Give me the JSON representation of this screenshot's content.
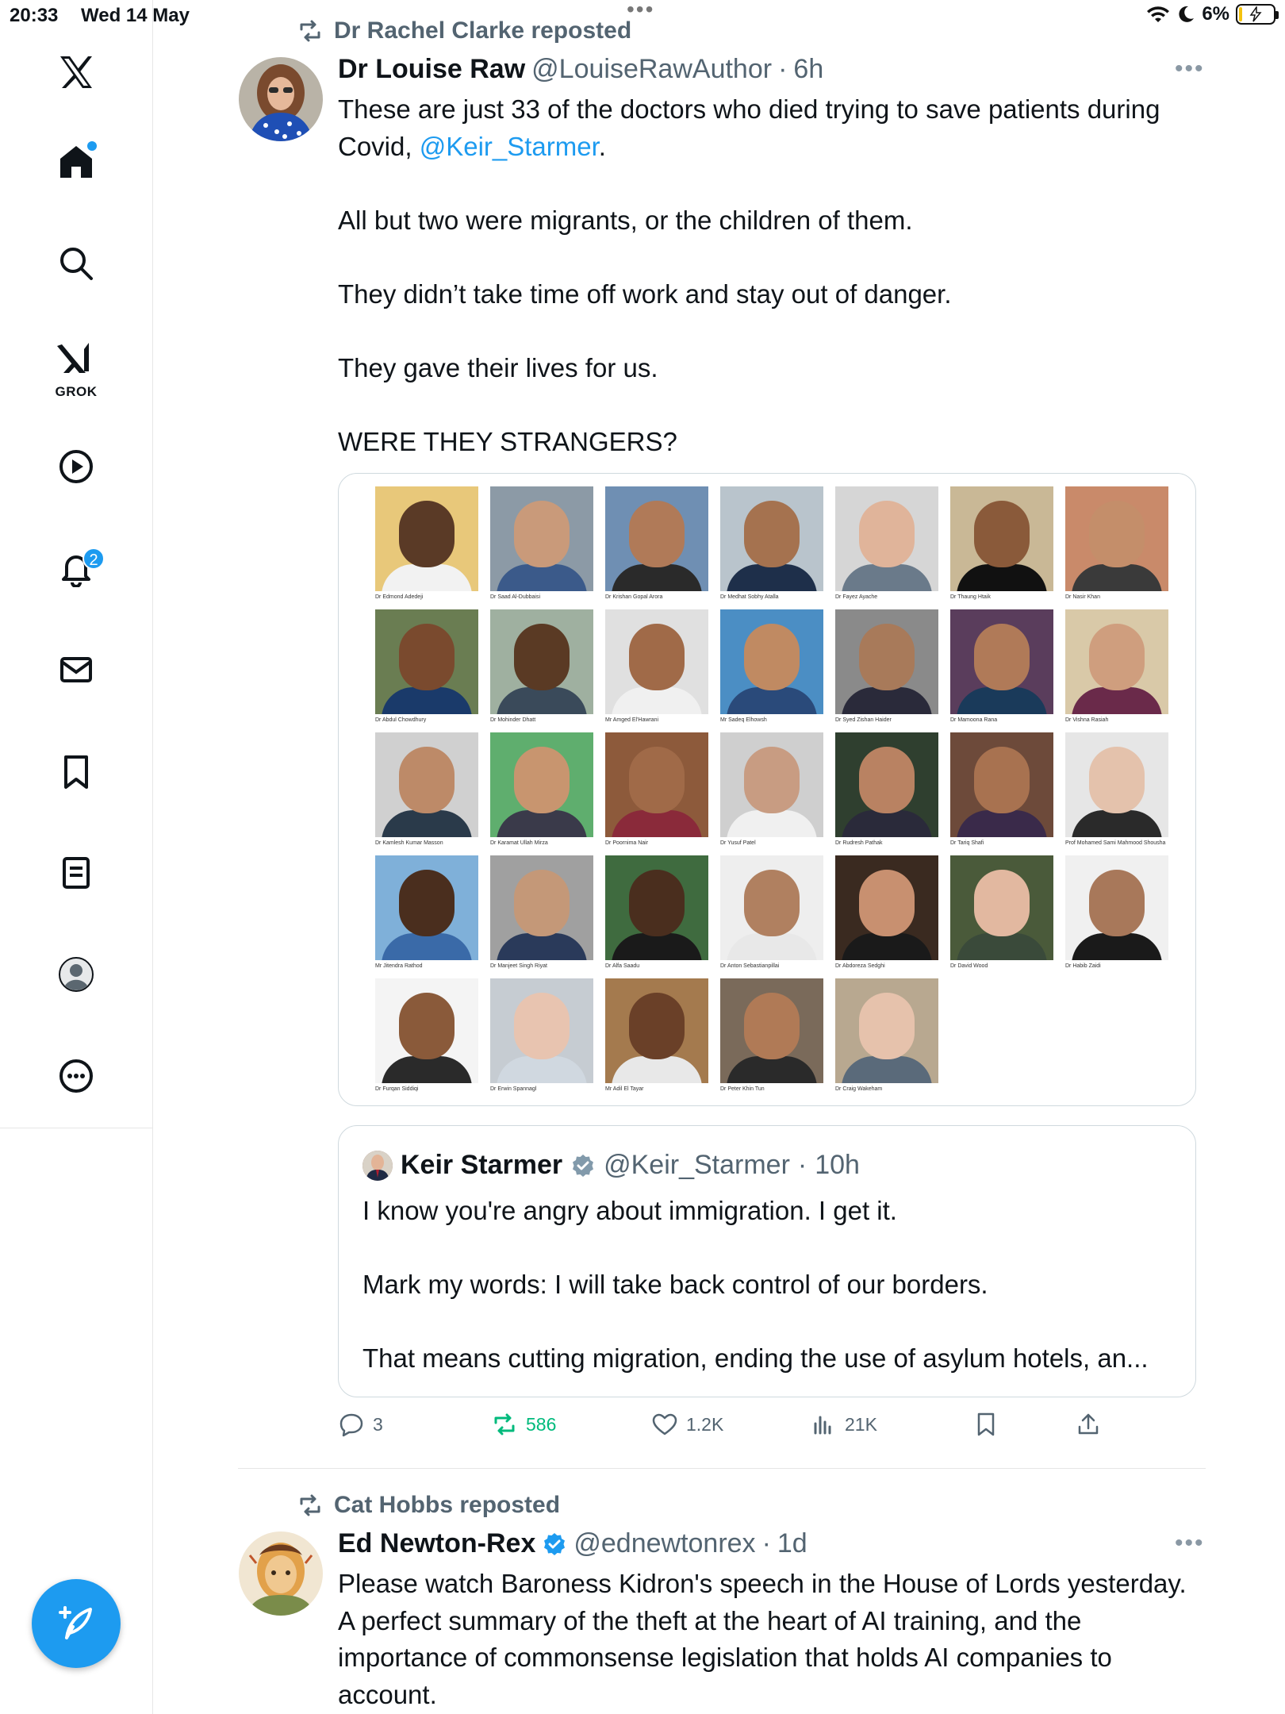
{
  "status_bar": {
    "time": "20:33",
    "date": "Wed 14 May",
    "battery": "6%",
    "battery_level": 0.06
  },
  "sidebar": {
    "items": [
      {
        "name": "x-logo-icon"
      },
      {
        "name": "home-icon"
      },
      {
        "name": "search-icon"
      },
      {
        "name": "grok-icon",
        "label": "GROK"
      },
      {
        "name": "video-icon"
      },
      {
        "name": "notifications-icon",
        "badge": "2"
      },
      {
        "name": "messages-icon"
      },
      {
        "name": "bookmarks-icon"
      },
      {
        "name": "lists-icon"
      },
      {
        "name": "profile-icon"
      },
      {
        "name": "more-icon"
      }
    ],
    "compose": "compose-icon"
  },
  "tweet1": {
    "reposted_by": "Dr Rachel Clarke reposted",
    "author_name": "Dr Louise Raw",
    "author_handle": "@LouiseRawAuthor",
    "time": "6h",
    "text_intro": "These are just 33 of the doctors who died trying to save patients during Covid, ",
    "mention": "@Keir_Starmer",
    "text_after_mention": ".",
    "text_rest": "\nAll but two were migrants, or the children of them.\n\nThey didn’t take time off work and stay out of danger.\n\nThey gave their lives for us.\n\nWERE THEY STRANGERS?",
    "photo_captions": [
      "Dr Edmond Adedeji",
      "Dr Saad Al-Dubbaisi",
      "Dr Krishan Gopal Arora",
      "Dr Medhat Sobhy Atalla",
      "Dr Fayez Ayache",
      "Dr Thaung Htaik",
      "Dr Nasir Khan",
      "Dr Abdul Chowdhury",
      "Dr Mohinder Dhatt",
      "Mr Amged El'Hawrani",
      "Mr Sadeq Elhowsh",
      "Dr Syed Zishan Haider",
      "Dr Mamoona Rana",
      "Dr Vishna Rasiah",
      "Dr Kamlesh Kumar Masson",
      "Dr Karamat Ullah Mirza",
      "Dr Poornima Nair",
      "Dr Yusuf Patel",
      "Dr Rudresh Pathak",
      "Dr Tariq Shafi",
      "Prof Mohamed Sami Mahmood Shousha",
      "Mr Jitendra Rathod",
      "Dr Manjeet Singh Riyat",
      "Dr Alfa Saadu",
      "Dr Anton Sebastianpillai",
      "Dr Abdoreza Sedghi",
      "Dr David Wood",
      "Dr Habib Zaidi",
      "Dr Furqan Siddiqi",
      "Dr Erwin Spannagl",
      "Mr Adil El Tayar",
      "Dr Peter Khin Tun",
      "Dr Craig Wakeham"
    ],
    "quote": {
      "author_name": "Keir Starmer",
      "author_handle": "@Keir_Starmer",
      "time": "10h",
      "text": "I know you're angry about immigration. I get it.\n\nMark my words: I will take back control of our borders.\n\nThat means cutting migration, ending the use of asylum hotels, an..."
    },
    "stats": {
      "replies": "3",
      "reposts": "586",
      "likes": "1.2K",
      "views": "21K"
    }
  },
  "tweet2": {
    "reposted_by": "Cat Hobbs reposted",
    "author_name": "Ed Newton-Rex",
    "author_handle": "@ednewtonrex",
    "time": "1d",
    "text": "Please watch Baroness Kidron's speech in the House of Lords yesterday. A perfect summary of the theft at the heart of AI training, and the importance of commonsense legislation that holds AI companies to account."
  },
  "separator": "·",
  "colors": {
    "accent": "#1d9bf0",
    "repost_green": "#00ba7c",
    "secondary_text": "#536471",
    "border": "#cfd9de"
  }
}
